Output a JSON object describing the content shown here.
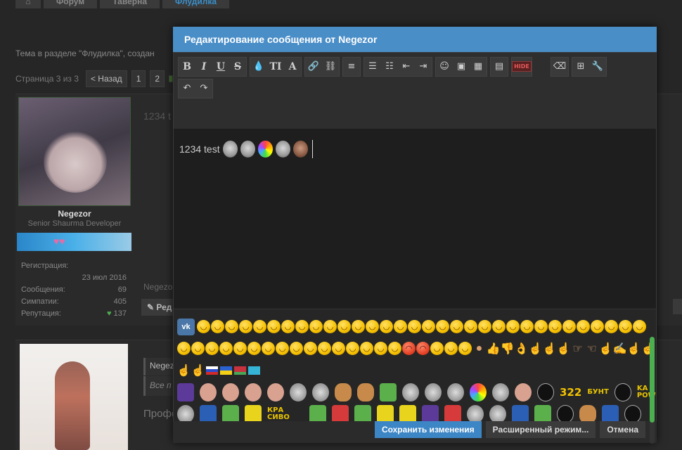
{
  "background": {
    "breadcrumbs": [
      "Форум",
      "Таверна",
      "Флудилка"
    ],
    "topic_line": "Тема в разделе \"Флудилка\", создан",
    "pager": {
      "label": "Страница 3 из 3",
      "prev": "< Назад",
      "pages": [
        "1",
        "2"
      ]
    },
    "post1": {
      "text": "1234 t",
      "username": "Negezor",
      "user_title": "Senior Shaurma Developer",
      "stats": [
        {
          "label": "Регистрация:",
          "value": ""
        },
        {
          "label": "",
          "value": "23 июл 2016"
        },
        {
          "label": "Сообщения:",
          "value": "69"
        },
        {
          "label": "Симпатии:",
          "value": "405"
        },
        {
          "label": "Репутация:",
          "value": "137"
        }
      ],
      "signature_name": "Negezo",
      "reply_label": "Ред"
    },
    "post2": {
      "quote_author": "Negez",
      "quote_text": "Все п",
      "profile_text": "Профо"
    }
  },
  "modal": {
    "title": "Редактирование сообщения от Negezor",
    "editor_text": "1234 test",
    "toolbar": {
      "row1": [
        [
          "B",
          "I",
          "U",
          "S"
        ],
        [
          "droplet-icon",
          "text-size-icon",
          "font-icon"
        ],
        [
          "link-icon",
          "unlink-icon"
        ],
        [
          "align-icon"
        ],
        [
          "bullet-list-icon",
          "numbered-list-icon",
          "outdent-icon",
          "indent-icon"
        ],
        [
          "smilie-icon",
          "image-icon",
          "media-icon"
        ],
        [
          "save-draft-icon"
        ],
        [
          "HIDE"
        ],
        [
          "eraser-icon"
        ],
        [
          "insert-icon",
          "settings-icon"
        ]
      ],
      "row2": [
        [
          "undo-icon",
          "redo-icon"
        ]
      ]
    },
    "smilies": {
      "vk_label": "vk",
      "text_emotes": [
        "322",
        "БУНТ",
        "KA POW",
        "КРА СИВО"
      ]
    },
    "buttons": {
      "save": "Сохранить изменения",
      "advanced": "Расширенный режим...",
      "cancel": "Отмена"
    }
  }
}
